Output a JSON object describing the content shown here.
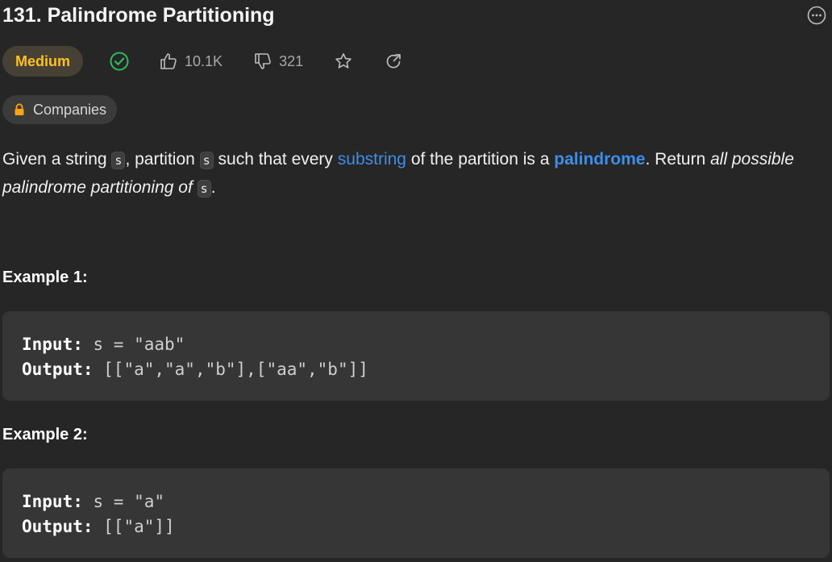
{
  "problem": {
    "title": "131. Palindrome Partitioning",
    "difficulty": "Medium",
    "likes": "10.1K",
    "dislikes": "321",
    "companies_label": "Companies"
  },
  "description": {
    "p1": "Given a string ",
    "code1": "s",
    "p2": ", partition ",
    "code2": "s",
    "p3": " such that every ",
    "link_substring": "substring",
    "p4": " of the partition is a ",
    "link_palindrome": "palindrome",
    "p5": ". Return ",
    "italic": "all possible palindrome partitioning of ",
    "code3": "s",
    "p6": "."
  },
  "examples": [
    {
      "label": "Example 1:",
      "input_label": "Input:",
      "input_value": " s = \"aab\"",
      "output_label": "Output:",
      "output_value": " [[\"a\",\"a\",\"b\"],[\"aa\",\"b\"]]"
    },
    {
      "label": "Example 2:",
      "input_label": "Input:",
      "input_value": " s = \"a\"",
      "output_label": "Output:",
      "output_value": " [[\"a\"]]"
    }
  ],
  "colors": {
    "background": "#262626",
    "medium": "#ffc01e",
    "solved": "#2cbb5d",
    "link": "#3b8eea",
    "lock": "#ffa116"
  }
}
